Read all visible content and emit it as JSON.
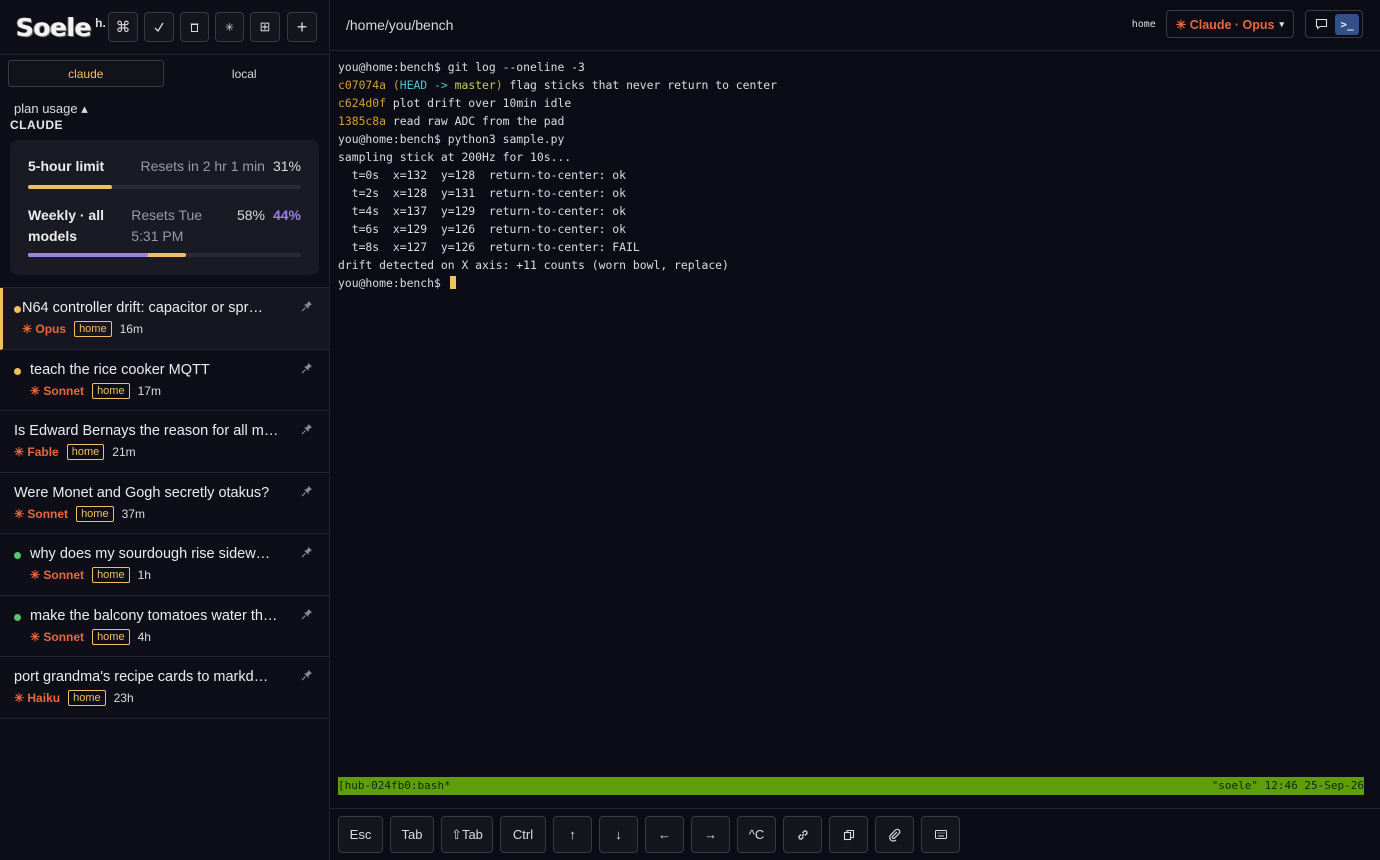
{
  "app": {
    "logo": "Soele",
    "logo_suffix": "h."
  },
  "toolbar": {
    "icons": [
      "command-icon",
      "check-icon",
      "trash-icon",
      "sparkle-icon",
      "grid-icon",
      "plus-icon"
    ],
    "cmd_glyph": "⌘",
    "check_glyph": "✓",
    "sparkle_glyph": "✳",
    "grid_glyph": "⊞",
    "plus_glyph": "+"
  },
  "segments": {
    "claude": "claude",
    "local": "local",
    "active": "claude"
  },
  "plan": {
    "toggle_label": "plan usage ▴",
    "provider": "CLAUDE",
    "five_hour": {
      "label": "5-hour limit",
      "reset": "Resets in 2 hr 1 min",
      "pct": "31%",
      "value": 31
    },
    "weekly": {
      "label": "Weekly · all models",
      "reset": "Resets Tue 5:31 PM",
      "pct": "58%",
      "pct_other": "44%",
      "value": 58,
      "value_other": 44
    }
  },
  "sessions": [
    {
      "title": "N64 controller drift: capacitor or spr…",
      "model": "✳ Opus",
      "tag": "home",
      "age": "16m",
      "dot": "#f0c060",
      "active": true
    },
    {
      "title": "teach the rice cooker MQTT",
      "model": "✳ Sonnet",
      "tag": "home",
      "age": "17m",
      "dot": "#f0c060",
      "active": false
    },
    {
      "title": "Is Edward Bernays the reason for all m…",
      "model": "✳ Fable",
      "tag": "home",
      "age": "21m",
      "dot": null,
      "active": false
    },
    {
      "title": "Were Monet and Gogh secretly otakus?",
      "model": "✳ Sonnet",
      "tag": "home",
      "age": "37m",
      "dot": null,
      "active": false
    },
    {
      "title": "why does my sourdough rise sidew…",
      "model": "✳ Sonnet",
      "tag": "home",
      "age": "1h",
      "dot": "#5cc46c",
      "active": false
    },
    {
      "title": "make the balcony tomatoes water th…",
      "model": "✳ Sonnet",
      "tag": "home",
      "age": "4h",
      "dot": "#5cc46c",
      "active": false
    },
    {
      "title": "port grandma's recipe cards to markd…",
      "model": "✳ Haiku",
      "tag": "home",
      "age": "23h",
      "dot": null,
      "active": false
    }
  ],
  "header": {
    "path": "/home/you/bench",
    "host": "home",
    "model_label": "✳ Claude · Opus",
    "caret": "▾"
  },
  "terminal": {
    "prompt": "you@home:bench$ ",
    "cmd1": "git log --oneline -3",
    "commits": [
      {
        "hash": "c07074a",
        "refs_open": " (",
        "ref_head": "HEAD -> master",
        "refs_close": ")",
        "msg": " flag sticks that never return to center"
      },
      {
        "hash": "c624d0f",
        "msg": " plot drift over 10min idle"
      },
      {
        "hash": "1385c8a",
        "msg": " read raw ADC from the pad"
      }
    ],
    "cmd2": "python3 sample.py",
    "output": [
      "sampling stick at 200Hz for 10s...",
      "  t=0s  x=132  y=128  return-to-center: ok",
      "  t=2s  x=128  y=131  return-to-center: ok",
      "  t=4s  x=137  y=129  return-to-center: ok",
      "  t=6s  x=129  y=126  return-to-center: ok",
      "  t=8s  x=127  y=126  return-to-center: FAIL",
      "drift detected on X axis: +11 counts (worn bowl, replace)"
    ]
  },
  "tmux": {
    "left": "[hub-024fb0:bash*",
    "right": "\"soele\" 12:46 25-Sep-26"
  },
  "keys": {
    "esc": "Esc",
    "tab": "Tab",
    "shift_tab": "⇧Tab",
    "ctrl": "Ctrl",
    "up": "↑",
    "down": "↓",
    "left": "←",
    "right": "→",
    "ctrl_c": "^C",
    "link_icon": "link-icon",
    "copy_icon": "copy-icon",
    "attach_icon": "paperclip-icon",
    "keyboard_icon": "keyboard-icon"
  },
  "colors": {
    "accent": "#f0c060",
    "model": "#e8683c",
    "weekly_other": "#9b80e6",
    "tmux_bar": "#5f9e0a"
  }
}
